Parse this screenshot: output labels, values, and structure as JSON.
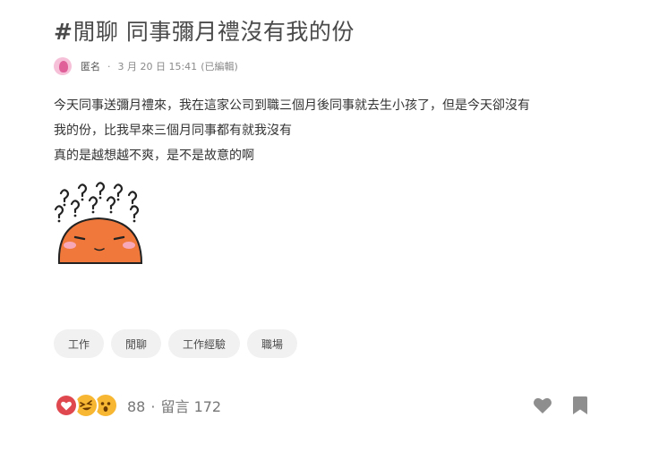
{
  "post": {
    "title_hash": "#",
    "title": "閒聊 同事彌月禮沒有我的份",
    "author": "匿名",
    "separator": "·",
    "datetime": "3 月 20 日 15:41",
    "edited": "(已編輯)",
    "body_lines": [
      "今天同事送彌月禮來，我在這家公司到職三個月後同事就去生小孩了，但是今天卻沒有",
      "我的份，比我早來三個月同事都有就我沒有",
      "真的是越想越不爽，是不是故意的啊"
    ]
  },
  "tags": [
    "工作",
    "閒聊",
    "工作經驗",
    "職場"
  ],
  "footer": {
    "reaction_icons": [
      "heart-icon",
      "haha-icon",
      "wow-icon"
    ],
    "reaction_count": "88",
    "dot": "·",
    "comments_label": "留言",
    "comments_count": "172"
  },
  "colors": {
    "heart": "#e0484f",
    "emoji": "#f7b733",
    "sticker": "#f0783a",
    "action_icon": "#8e8e8e"
  }
}
